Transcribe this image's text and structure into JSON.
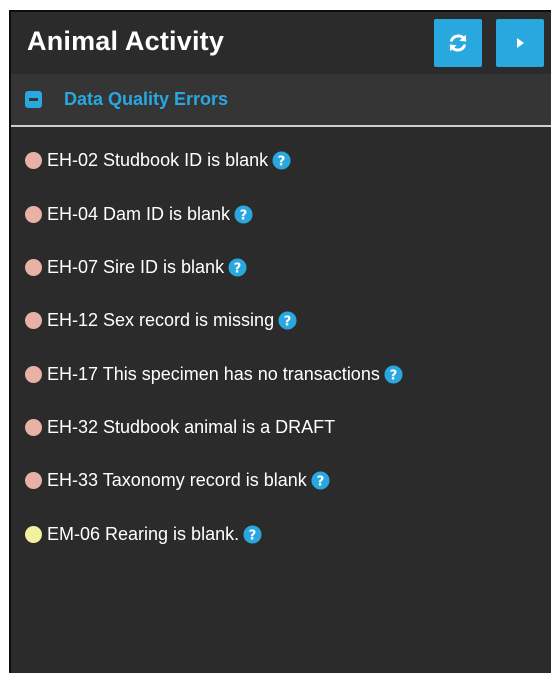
{
  "header": {
    "title": "Animal Activity",
    "refresh_icon": "refresh-icon",
    "next_icon": "chevron-right-icon"
  },
  "section": {
    "title": "Data Quality Errors",
    "collapse_icon": "minus-square-icon"
  },
  "items": [
    {
      "text": "EH-02 Studbook ID is blank",
      "severity": "error",
      "help": true
    },
    {
      "text": "EH-04 Dam ID is blank",
      "severity": "error",
      "help": true
    },
    {
      "text": "EH-07 Sire ID is blank",
      "severity": "error",
      "help": true
    },
    {
      "text": "EH-12 Sex record is missing",
      "severity": "error",
      "help": true
    },
    {
      "text": "EH-17 This specimen has no transactions",
      "severity": "error",
      "help": true
    },
    {
      "text": "EH-32 Studbook animal is a DRAFT",
      "severity": "error",
      "help": false
    },
    {
      "text": "EH-33 Taxonomy record is blank",
      "severity": "error",
      "help": true
    },
    {
      "text": "EM-06 Rearing is blank.",
      "severity": "warning",
      "help": true
    }
  ],
  "colors": {
    "panel_bg": "#2b2b2b",
    "accent": "#29a8e0",
    "error_dot": "#e8b1a6",
    "warning_dot": "#f2ef9e"
  }
}
